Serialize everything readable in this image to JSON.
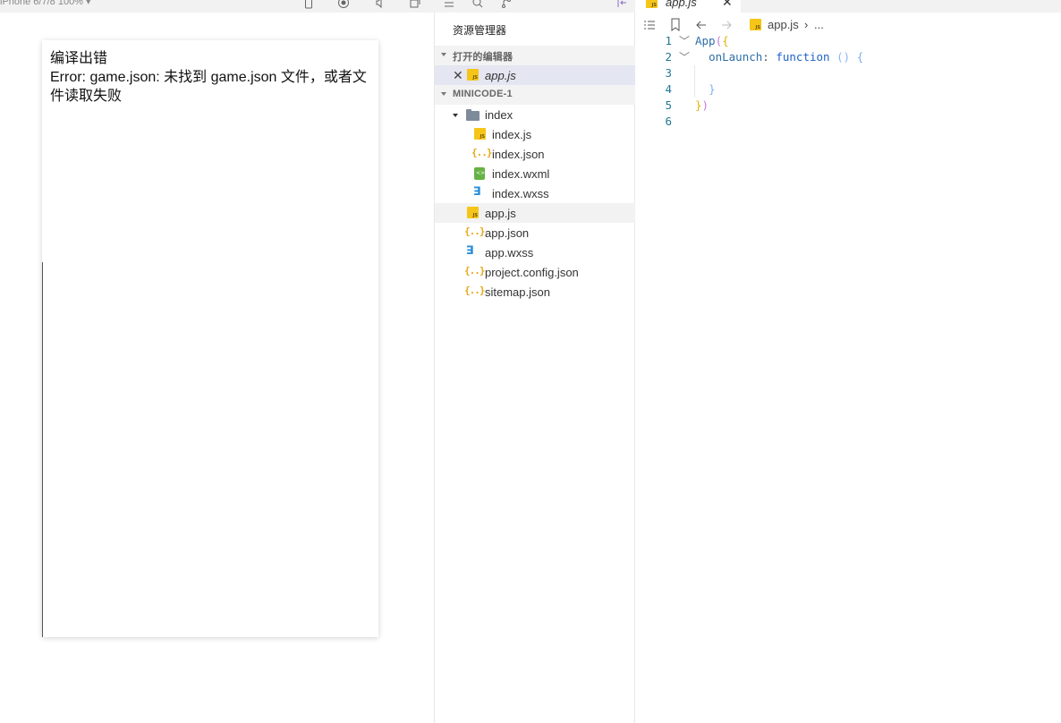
{
  "simulator": {
    "device_label": "iPhone 6/7/8 100% ▾",
    "error_title": "编译出错",
    "error_message": "Error: game.json: 未找到 game.json 文件，或者文件读取失败"
  },
  "explorer": {
    "title": "资源管理器",
    "open_editors_label": "打开的编辑器",
    "open_editors": [
      {
        "name": "app.js",
        "icon": "js-file-icon",
        "closable": true
      }
    ],
    "project_label": "MINICODE-1",
    "tree": [
      {
        "name": "index",
        "type": "folder",
        "icon": "folder-icon",
        "expanded": true
      },
      {
        "name": "index.js",
        "type": "file",
        "icon": "js-file-icon"
      },
      {
        "name": "index.json",
        "type": "file",
        "icon": "json-file-icon"
      },
      {
        "name": "index.wxml",
        "type": "file",
        "icon": "wxml-file-icon"
      },
      {
        "name": "index.wxss",
        "type": "file",
        "icon": "wxss-file-icon"
      },
      {
        "name": "app.js",
        "type": "file",
        "icon": "js-file-icon",
        "active": true
      },
      {
        "name": "app.json",
        "type": "file",
        "icon": "json-file-icon"
      },
      {
        "name": "app.wxss",
        "type": "file",
        "icon": "wxss-file-icon"
      },
      {
        "name": "project.config.json",
        "type": "file",
        "icon": "json-file-icon"
      },
      {
        "name": "sitemap.json",
        "type": "file",
        "icon": "json-file-icon"
      }
    ]
  },
  "editor": {
    "tab_label": "app.js",
    "breadcrumb_file": "app.js",
    "breadcrumb_sep": "›",
    "breadcrumb_more": "...",
    "lines": [
      {
        "number": "1"
      },
      {
        "number": "2"
      },
      {
        "number": "3"
      },
      {
        "number": "4"
      },
      {
        "number": "5"
      },
      {
        "number": "6"
      }
    ],
    "code": {
      "l1_ident": "App",
      "l1_paren": "(",
      "l1_brace": "{",
      "l2_key": "onLaunch",
      "l2_colon": ":",
      "l2_kw": "function",
      "l2_parens": "()",
      "l2_brace": "{",
      "l4_brace": "}",
      "l5_brace": "}",
      "l5_paren": ")"
    }
  },
  "colors": {
    "accent_selection": "#e4e6f1",
    "js_icon": "#f5c518",
    "json_icon": "#e6a817",
    "wxml_icon": "#66b245",
    "wxss_icon": "#2a8fdb"
  }
}
